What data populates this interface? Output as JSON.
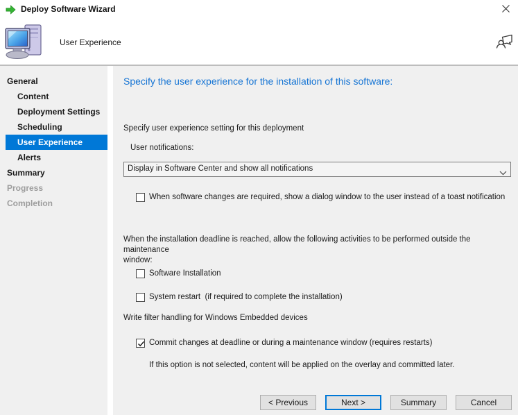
{
  "window": {
    "title": "Deploy Software Wizard"
  },
  "header": {
    "page_title": "User Experience"
  },
  "sidebar": {
    "items": [
      {
        "label": "General",
        "level": 0,
        "state": "normal"
      },
      {
        "label": "Content",
        "level": 1,
        "state": "normal"
      },
      {
        "label": "Deployment Settings",
        "level": 1,
        "state": "normal"
      },
      {
        "label": "Scheduling",
        "level": 1,
        "state": "normal"
      },
      {
        "label": "User Experience",
        "level": 1,
        "state": "selected"
      },
      {
        "label": "Alerts",
        "level": 1,
        "state": "normal"
      },
      {
        "label": "Summary",
        "level": 0,
        "state": "normal"
      },
      {
        "label": "Progress",
        "level": 0,
        "state": "disabled"
      },
      {
        "label": "Completion",
        "level": 0,
        "state": "disabled"
      }
    ]
  },
  "main": {
    "heading": "Specify the user experience for the installation of this software:",
    "intro": "Specify user experience setting for this deployment",
    "user_notifications_label": "User notifications:",
    "user_notifications_dropdown": {
      "selected_value": "Display in Software Center and show all notifications"
    },
    "dialog_window_checkbox": {
      "label": "When software changes are required, show a dialog window to the user instead of a toast notification",
      "checked": false
    },
    "deadline_paragraph": "When the installation deadline is reached, allow the following activities to be performed outside the maintenance\nwindow:",
    "software_installation_checkbox": {
      "label": "Software Installation",
      "checked": false
    },
    "system_restart_checkbox": {
      "label": "System restart  (if required to complete the installation)",
      "checked": false
    },
    "write_filter_text": "Write filter handling for Windows Embedded devices",
    "commit_changes_checkbox": {
      "label": "Commit changes at deadline or during a maintenance window (requires restarts)",
      "checked": true
    },
    "commit_note": "If this option is not selected, content will be applied on the overlay and committed later."
  },
  "buttons": {
    "previous": "< Previous",
    "next": "Next >",
    "summary": "Summary",
    "cancel": "Cancel"
  },
  "colors": {
    "accent_blue": "#0078d7",
    "heading_blue": "#1574d4",
    "body_gray": "#f0f0f0",
    "disabled_text": "#9d9d9d",
    "button_face": "#e1e1e1",
    "wizard_arrow_green": "#35b534"
  }
}
